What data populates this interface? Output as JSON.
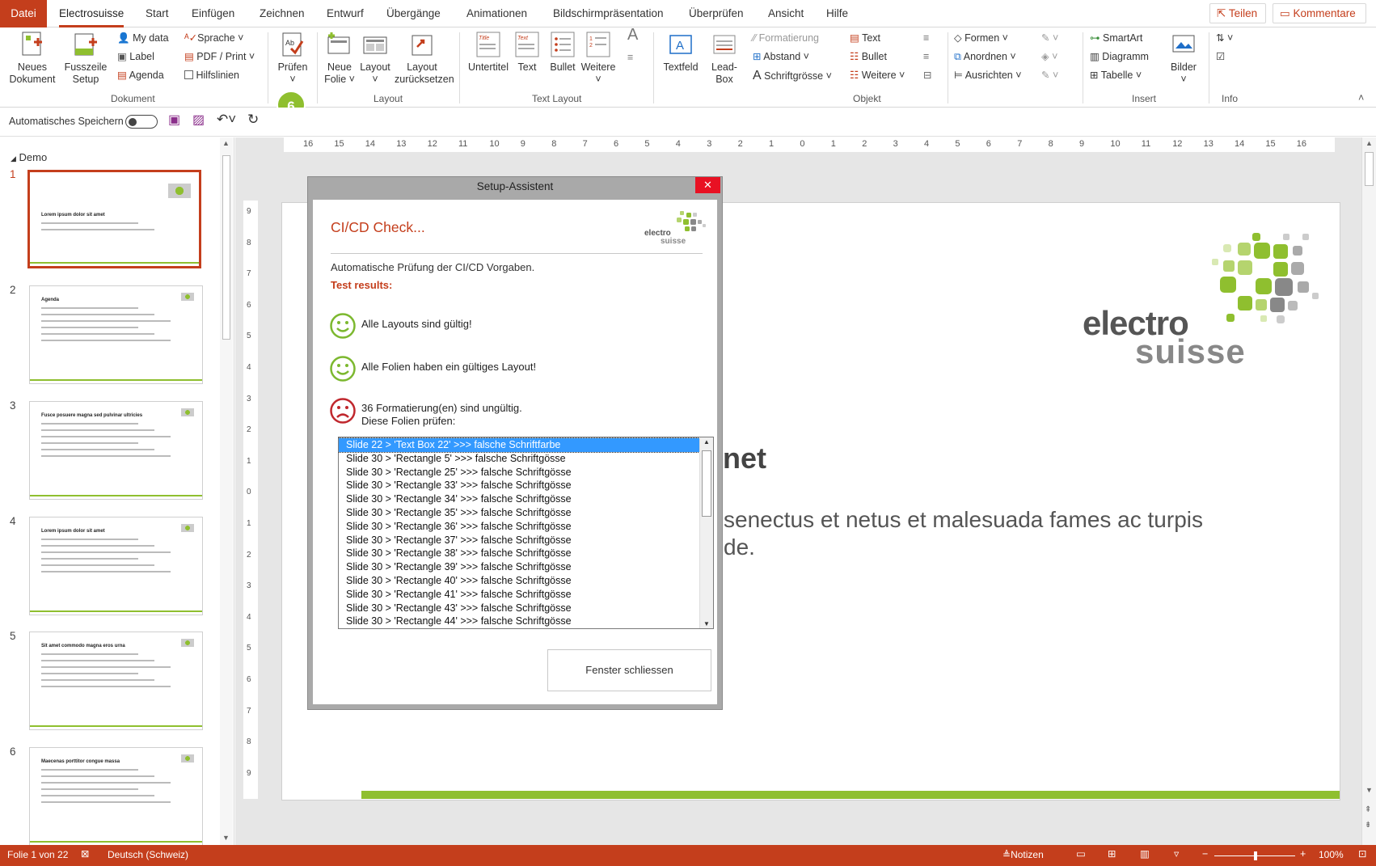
{
  "tabs": {
    "file": "Datei",
    "electrosuisse": "Electrosuisse",
    "start": "Start",
    "insert": "Einfügen",
    "draw": "Zeichnen",
    "design": "Entwurf",
    "transitions": "Übergänge",
    "animations": "Animationen",
    "slideshow": "Bildschirmpräsentation",
    "review": "Überprüfen",
    "view": "Ansicht",
    "help": "Hilfe",
    "share": "Teilen",
    "comments": "Kommentare"
  },
  "ribbon": {
    "new_doc": [
      "Neues",
      "Dokument"
    ],
    "footer_setup": [
      "Fusszeile",
      "Setup"
    ],
    "my_data": "My data",
    "label": "Label",
    "agenda": "Agenda",
    "language": "Sprache",
    "pdf_print": "PDF / Print",
    "gridlines": "Hilfslinien",
    "group_document": "Dokument",
    "check": "Prüfen",
    "new_slide": [
      "Neue",
      "Folie"
    ],
    "layout": "Layout",
    "reset_layout": [
      "Layout",
      "zurücksetzen"
    ],
    "group_layout": "Layout",
    "subtitle": "Untertitel",
    "text": "Text",
    "bullet": "Bullet",
    "more": "Weitere",
    "group_text_layout": "Text Layout",
    "textfield": "Textfeld",
    "lead_box": [
      "Lead-",
      "Box"
    ],
    "formatting": "Formatierung",
    "spacing": "Abstand",
    "font_size": "Schriftgrösse",
    "obj_text": "Text",
    "obj_bullet": "Bullet",
    "obj_more": "Weitere",
    "group_object": "Objekt",
    "shapes": "Formen",
    "arrange": "Anordnen",
    "align": "Ausrichten",
    "smartart": "SmartArt",
    "diagram": "Diagramm",
    "table": "Tabelle",
    "images": "Bilder",
    "group_insert": "Insert",
    "group_info": "Info",
    "badge": "6",
    "title_thumb": "Title",
    "text_thumb": "Text"
  },
  "qat": {
    "autosave": "Automatisches Speichern"
  },
  "pane": {
    "section": "Demo",
    "slides": [
      {
        "num": "1",
        "title": "Lorem ipsum dolor sit amet"
      },
      {
        "num": "2",
        "title": "Agenda"
      },
      {
        "num": "3",
        "title": "Fusce posuere magna sed pulvinar ultricies"
      },
      {
        "num": "4",
        "title": "Lorem ipsum dolor sit amet"
      },
      {
        "num": "5",
        "title": "Sit amet commodo magna eros urna"
      },
      {
        "num": "6",
        "title": "Maecenas porttitor congue massa"
      }
    ]
  },
  "ruler": {
    "h_ticks": [
      "16",
      "15",
      "14",
      "13",
      "12",
      "11",
      "10",
      "9",
      "8",
      "7",
      "6",
      "5",
      "4",
      "3",
      "2",
      "1",
      "0",
      "1",
      "2",
      "3",
      "4",
      "5",
      "6",
      "7",
      "8",
      "9",
      "10",
      "11",
      "12",
      "13",
      "14",
      "15",
      "16"
    ],
    "v_ticks": [
      "9",
      "8",
      "7",
      "6",
      "5",
      "4",
      "3",
      "2",
      "1",
      "0",
      "1",
      "2",
      "3",
      "4",
      "5",
      "6",
      "7",
      "8",
      "9"
    ]
  },
  "slide": {
    "logo_line1": "electro",
    "logo_line2": "suisse",
    "title_visible": "net",
    "body_line1": "senectus et netus et malesuada fames ac turpis",
    "body_line2": "de."
  },
  "dialog": {
    "title": "Setup-Assistent",
    "close": "✕",
    "heading": "CI/CD Check...",
    "logo_line1": "electro",
    "logo_line2": "suisse",
    "intro": "Automatische Prüfung der CI/CD Vorgaben.",
    "results_label": "Test results:",
    "result1": "Alle Layouts sind gültig!",
    "result2": "Alle Folien haben ein gültiges Layout!",
    "result3_line1": "36 Formatierung(en) sind ungültig.",
    "result3_line2": "Diese Folien prüfen:",
    "items": [
      "Slide 22 > 'Text Box 22' >>> falsche Schriftfarbe",
      "Slide 30 > 'Rectangle 5' >>> falsche Schriftgösse",
      "Slide 30 > 'Rectangle 25' >>> falsche Schriftgösse",
      "Slide 30 > 'Rectangle 33' >>> falsche Schriftgösse",
      "Slide 30 > 'Rectangle 34' >>> falsche Schriftgösse",
      "Slide 30 > 'Rectangle 35' >>> falsche Schriftgösse",
      "Slide 30 > 'Rectangle 36' >>> falsche Schriftgösse",
      "Slide 30 > 'Rectangle 37' >>> falsche Schriftgösse",
      "Slide 30 > 'Rectangle 38' >>> falsche Schriftgösse",
      "Slide 30 > 'Rectangle 39' >>> falsche Schriftgösse",
      "Slide 30 > 'Rectangle 40' >>> falsche Schriftgösse",
      "Slide 30 > 'Rectangle 41' >>> falsche Schriftgösse",
      "Slide 30 > 'Rectangle 43' >>> falsche Schriftgösse",
      "Slide 30 > 'Rectangle 44' >>> falsche Schriftgösse"
    ],
    "close_button": "Fenster schliessen"
  },
  "status": {
    "slide_count": "Folie 1 von 22",
    "language": "Deutsch (Schweiz)",
    "notes": "Notizen",
    "zoom": "100%"
  },
  "colors": {
    "accent": "#c43e1c",
    "green": "#8fbf2f",
    "ok": "#7cb82f",
    "error": "#c0272d"
  }
}
